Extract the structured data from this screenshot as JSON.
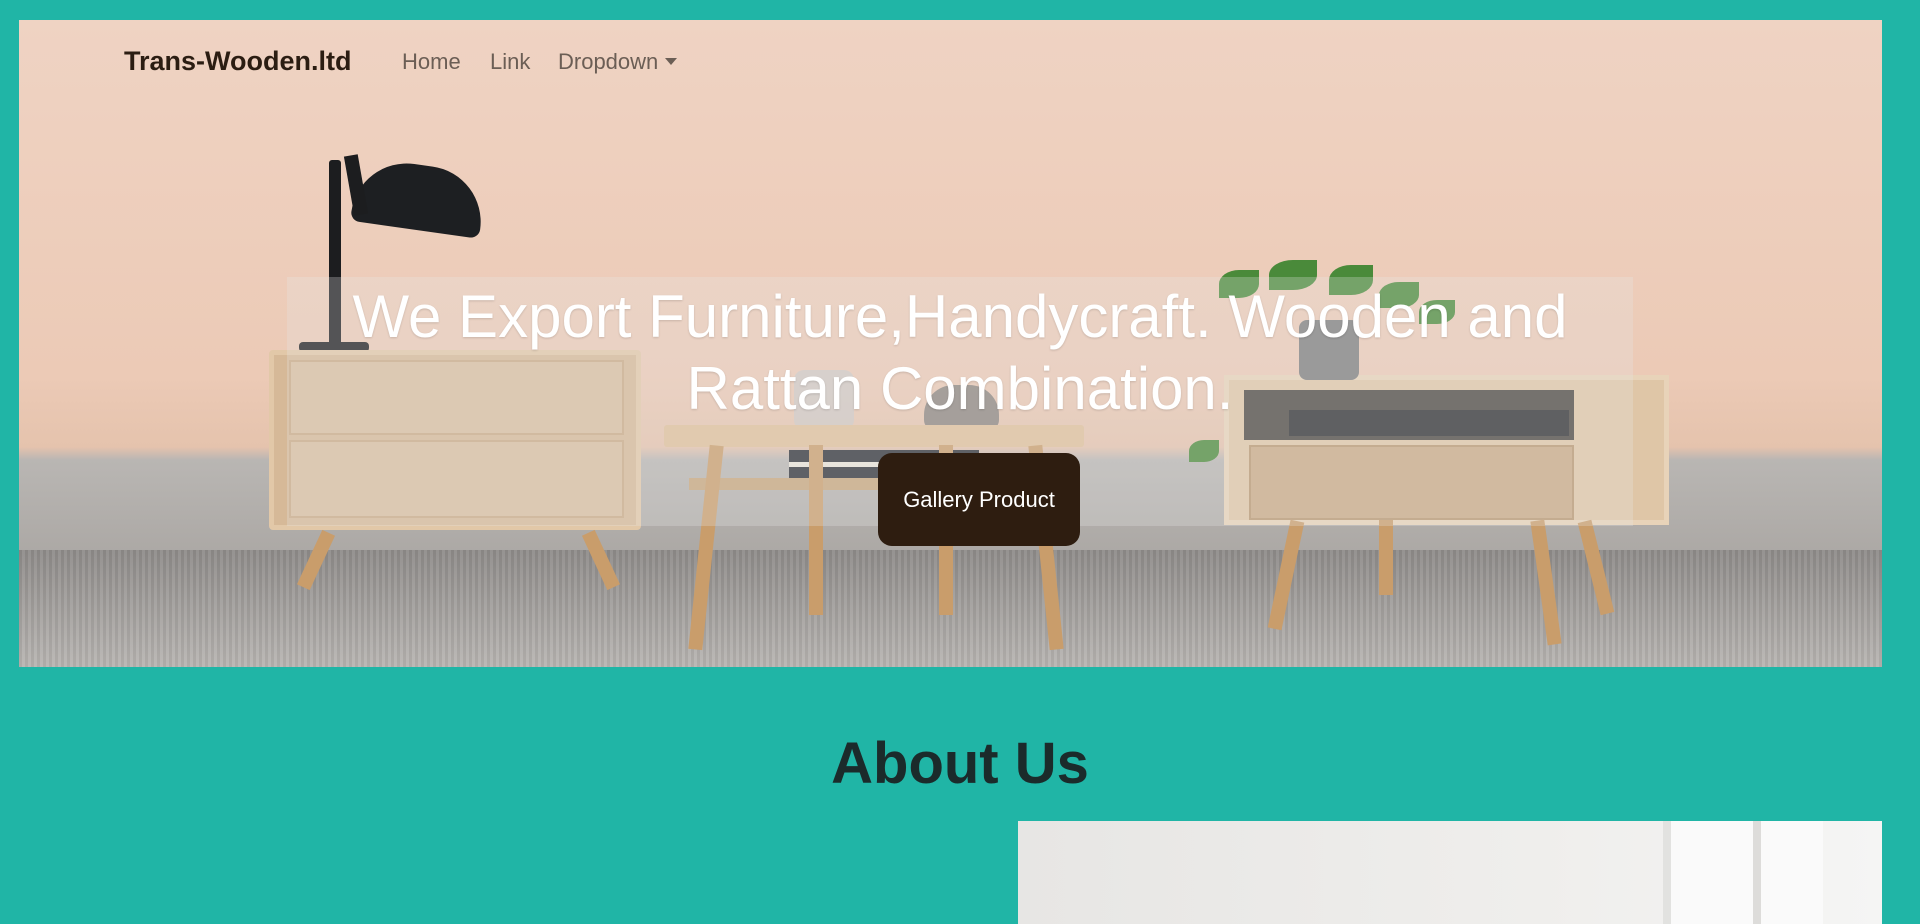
{
  "navbar": {
    "brand": "Trans-Wooden.ltd",
    "links": [
      "Home",
      "Link",
      "Dropdown"
    ]
  },
  "hero": {
    "headline": "We Export Furniture,Handycraft. Wooden and Rattan Combination.",
    "cta_label": "Gallery Product",
    "image_alt": "Wooden furniture room with lamp, side table, coffee table and plant"
  },
  "about": {
    "title": "About Us"
  },
  "colors": {
    "page_background": "#20b5a6",
    "button_background": "#2e1d10",
    "brand_text": "#2b1d12"
  }
}
